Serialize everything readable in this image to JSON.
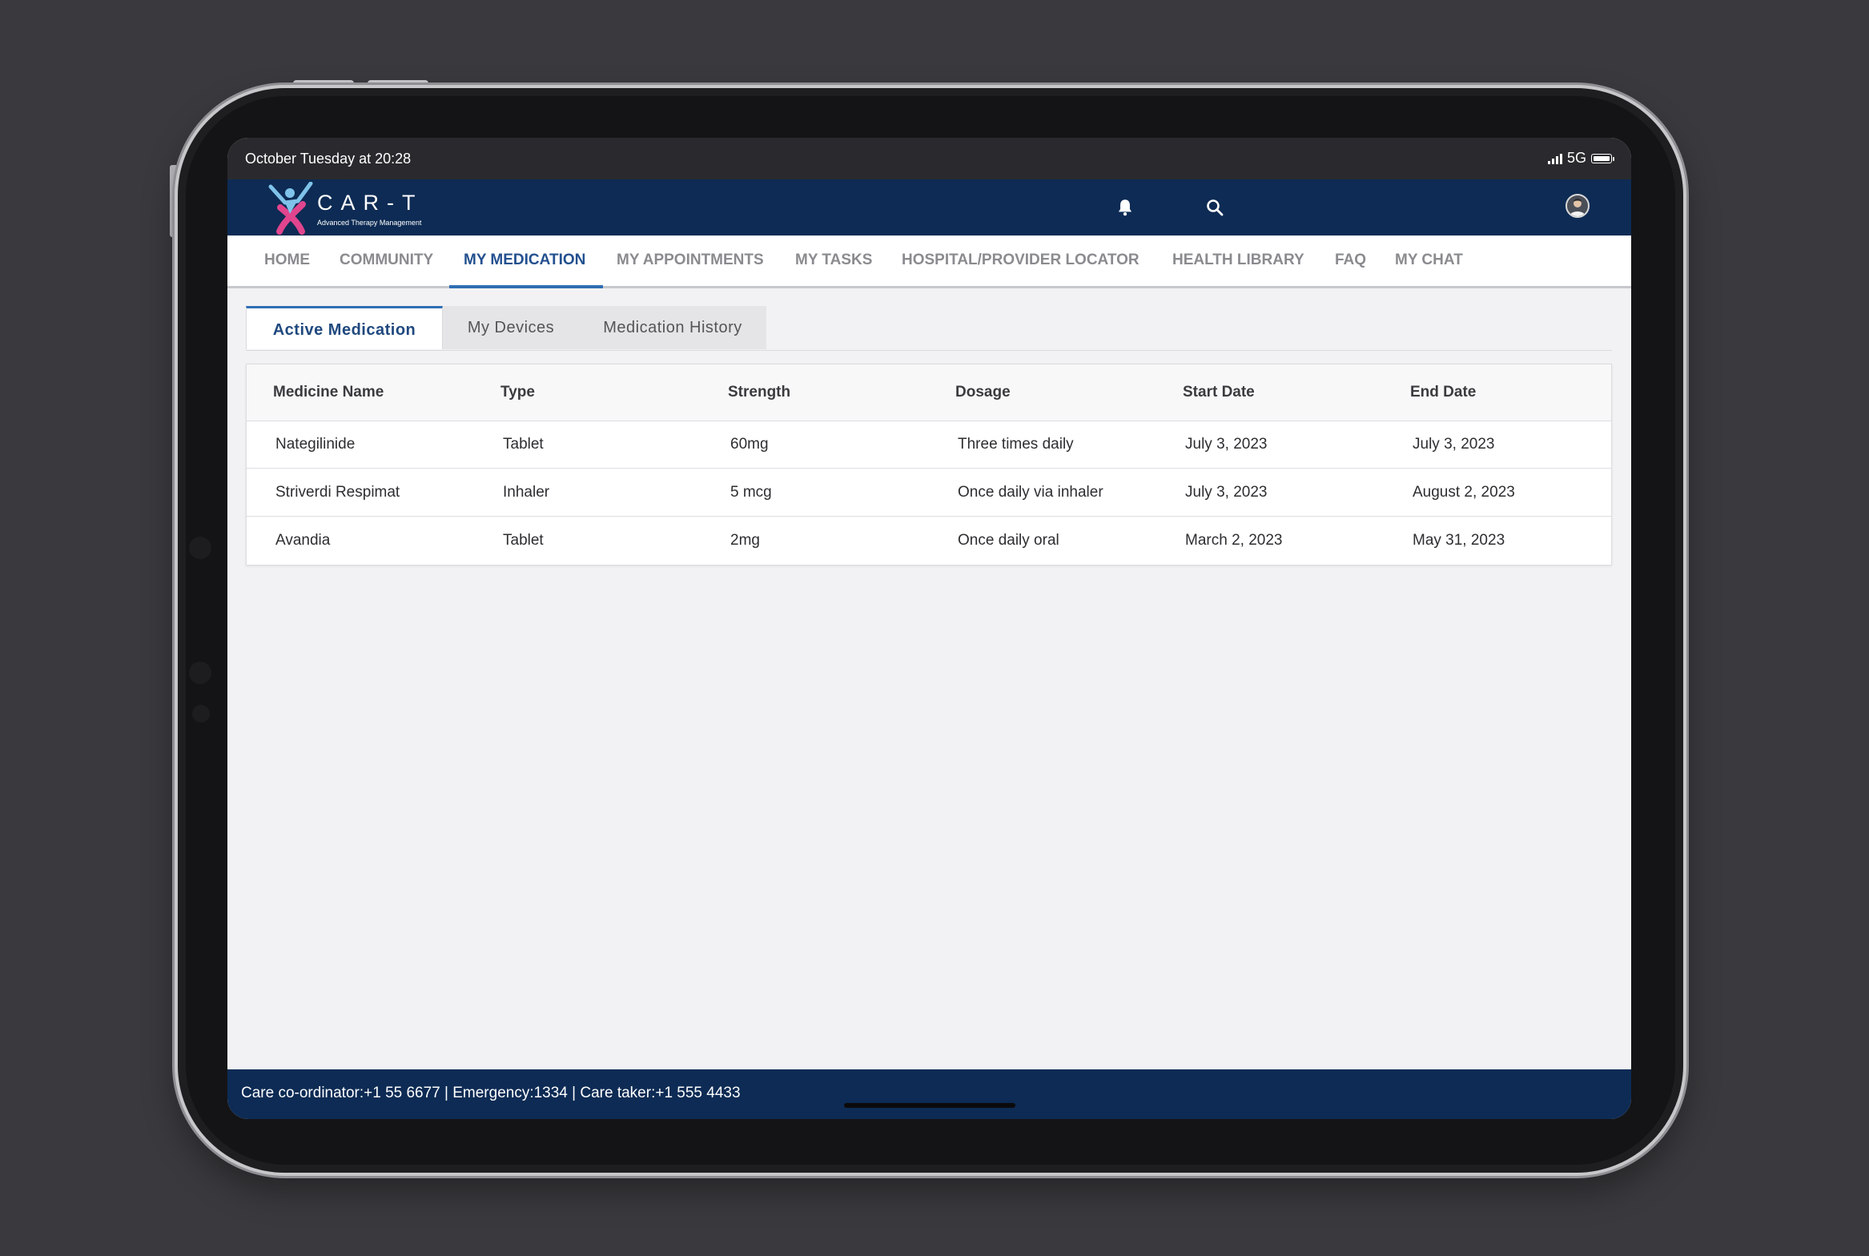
{
  "status_bar": {
    "datetime": "October Tuesday at 20:28",
    "network": "5G"
  },
  "header": {
    "brand_name": "CAR-T",
    "brand_tagline": "Advanced Therapy Management",
    "icons": [
      "search-icon",
      "bell-icon",
      "user-avatar"
    ],
    "brand_colors": {
      "navy": "#0d2b54",
      "pink": "#e0458e",
      "light_blue": "#7fc3ea"
    }
  },
  "nav": {
    "items": [
      {
        "label": "HOME"
      },
      {
        "label": "COMMUNITY"
      },
      {
        "label": "MY MEDICATION"
      },
      {
        "label": "MY APPOINTMENTS"
      },
      {
        "label": "MY TASKS"
      },
      {
        "label": "HOSPITAL/PROVIDER LOCATOR"
      },
      {
        "label": "HEALTH LIBRARY"
      },
      {
        "label": "FAQ"
      },
      {
        "label": "MY CHAT"
      }
    ],
    "active": "MY MEDICATION"
  },
  "tabs": {
    "items": [
      {
        "label": "Active Medication"
      },
      {
        "label": "My Devices"
      },
      {
        "label": "Medication History"
      }
    ],
    "active": "Active Medication"
  },
  "table": {
    "columns": [
      "Medicine Name",
      "Type",
      "Strength",
      "Dosage",
      "Start Date",
      "End Date"
    ],
    "rows": [
      [
        "Nategilinide",
        "Tablet",
        "60mg",
        "Three times daily",
        "July 3, 2023",
        "July 3, 2023"
      ],
      [
        "Striverdi Respimat",
        "Inhaler",
        "5 mcg",
        "Once daily via inhaler",
        "July 3, 2023",
        "August 2, 2023"
      ],
      [
        "Avandia",
        "Tablet",
        "2mg",
        "Once daily oral",
        "March 2, 2023",
        "May 31, 2023"
      ]
    ]
  },
  "footer": {
    "contact_line": "Care co-ordinator:+1 55 6677 | Emergency:1334 | Care taker:+1 555 4433"
  }
}
